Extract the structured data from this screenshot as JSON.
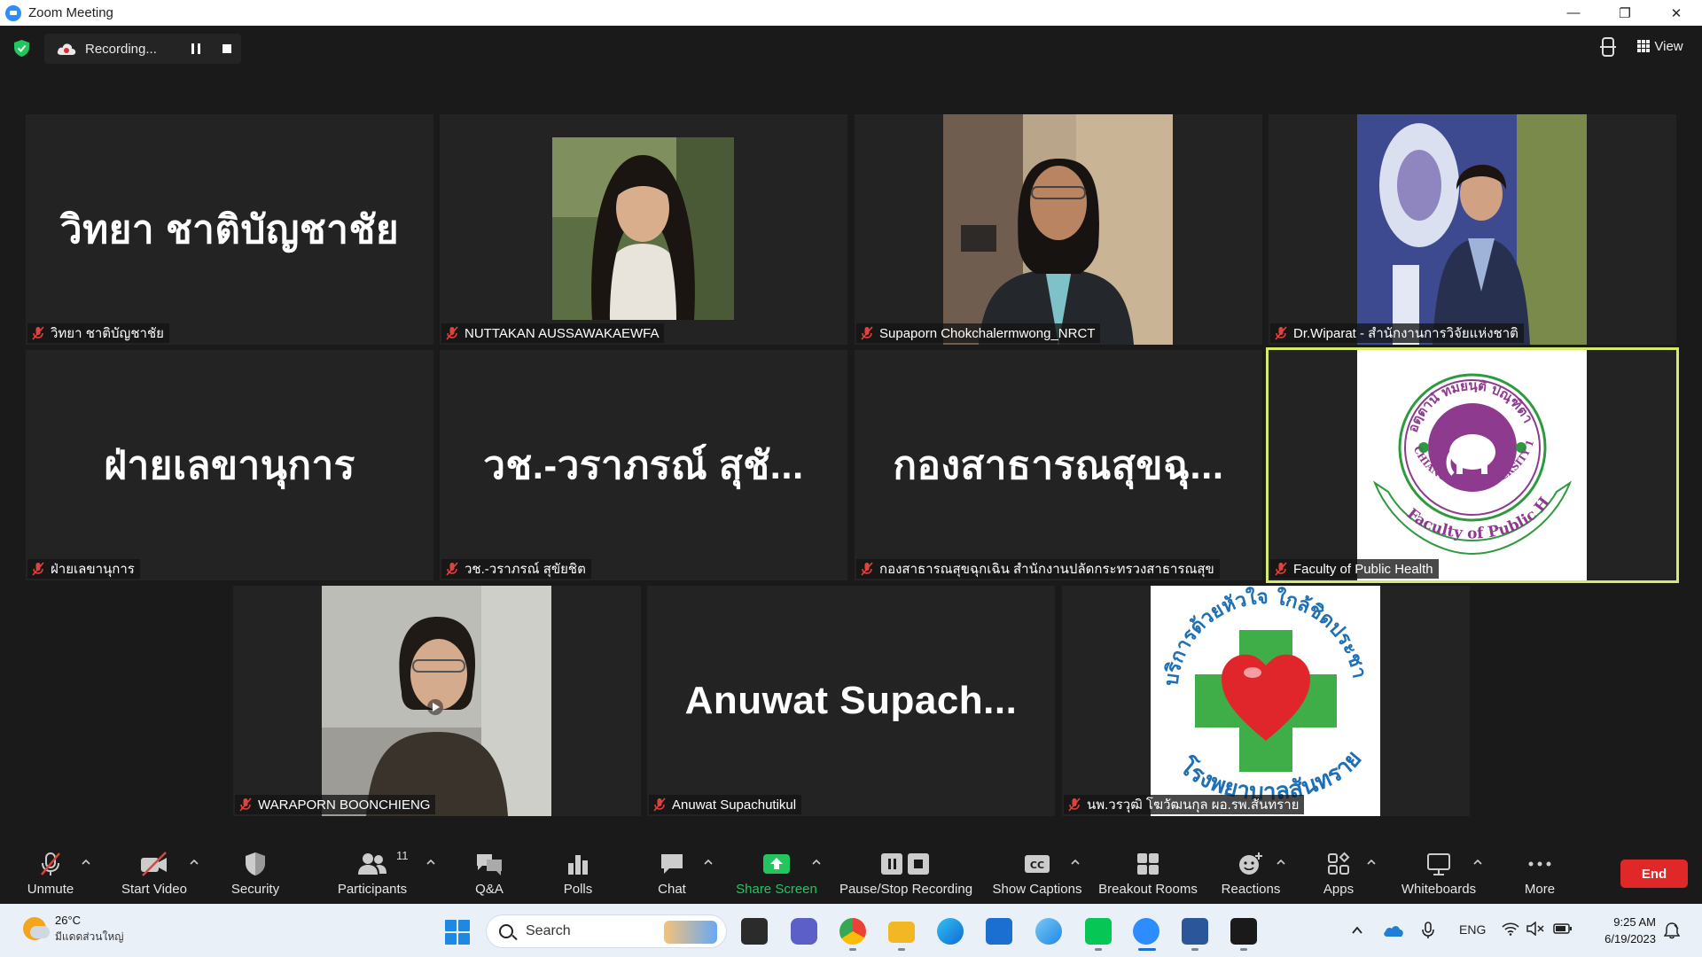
{
  "window": {
    "title": "Zoom Meeting"
  },
  "recording": {
    "label": "Recording..."
  },
  "view": {
    "label": "View"
  },
  "tiles": [
    {
      "caption": "วิทยา ชาติบัญชาชัย",
      "big_name": "วิทยา ชาติบัญชาชัย"
    },
    {
      "caption": "NUTTAKAN AUSSAWAKAEWFA"
    },
    {
      "caption": "Supaporn Chokchalermwong_NRCT"
    },
    {
      "caption": "Dr.Wiparat - สำนักงานการวิจัยแห่งชาติ"
    },
    {
      "caption": "ฝ่ายเลขานุการ",
      "big_name": "ฝ่ายเลขานุการ"
    },
    {
      "caption": "วช.-วราภรณ์ สุขัยชิต",
      "big_name": "วช.-วราภรณ์ สุชั..."
    },
    {
      "caption": "กองสาธารณสุขฉุกเฉิน สำนักงานปลัดกระทรวงสาธารณสุข",
      "big_name": "กองสาธารณสุขฉุ..."
    },
    {
      "caption": "Faculty of Public Health",
      "logo_ring_text": "Faculty of Public Health",
      "logo_top_text": "อตฺตานํ ทมยนฺติ ปณฺฑิตา",
      "logo_mid_text": "CHIANG MAI UNIVERSITY 1964"
    },
    {
      "caption": "WARAPORN BOONCHIENG"
    },
    {
      "caption": "Anuwat Supachutikul",
      "big_name": "Anuwat  Supach..."
    },
    {
      "caption": "นพ.วรวุฒิ โฆวัฒนกุล ผอ.รพ.สันทราย",
      "logo_top_text": "บริการด้วยหัวใจ ใกล้ชิดประชา",
      "logo_bottom_text": "โรงพยาบาลสันทราย"
    }
  ],
  "toolbar": {
    "unmute": "Unmute",
    "start_video": "Start Video",
    "security": "Security",
    "participants": "Participants",
    "participants_count": "11",
    "qa": "Q&A",
    "polls": "Polls",
    "chat": "Chat",
    "share_screen": "Share Screen",
    "pause_stop_recording": "Pause/Stop Recording",
    "show_captions": "Show Captions",
    "breakout_rooms": "Breakout Rooms",
    "reactions": "Reactions",
    "apps": "Apps",
    "whiteboards": "Whiteboards",
    "more": "More",
    "end": "End"
  },
  "taskbar": {
    "weather_temp": "26°C",
    "weather_location": "มีแดดส่วนใหญ่",
    "search_label": "Search",
    "language": "ENG",
    "time": "9:25 AM",
    "date": "6/19/2023"
  },
  "colors": {
    "share_green": "#22c55e",
    "end_red": "#e02828",
    "active_speaker": "#d6ea6b",
    "mic_off_red": "#e0433b"
  }
}
